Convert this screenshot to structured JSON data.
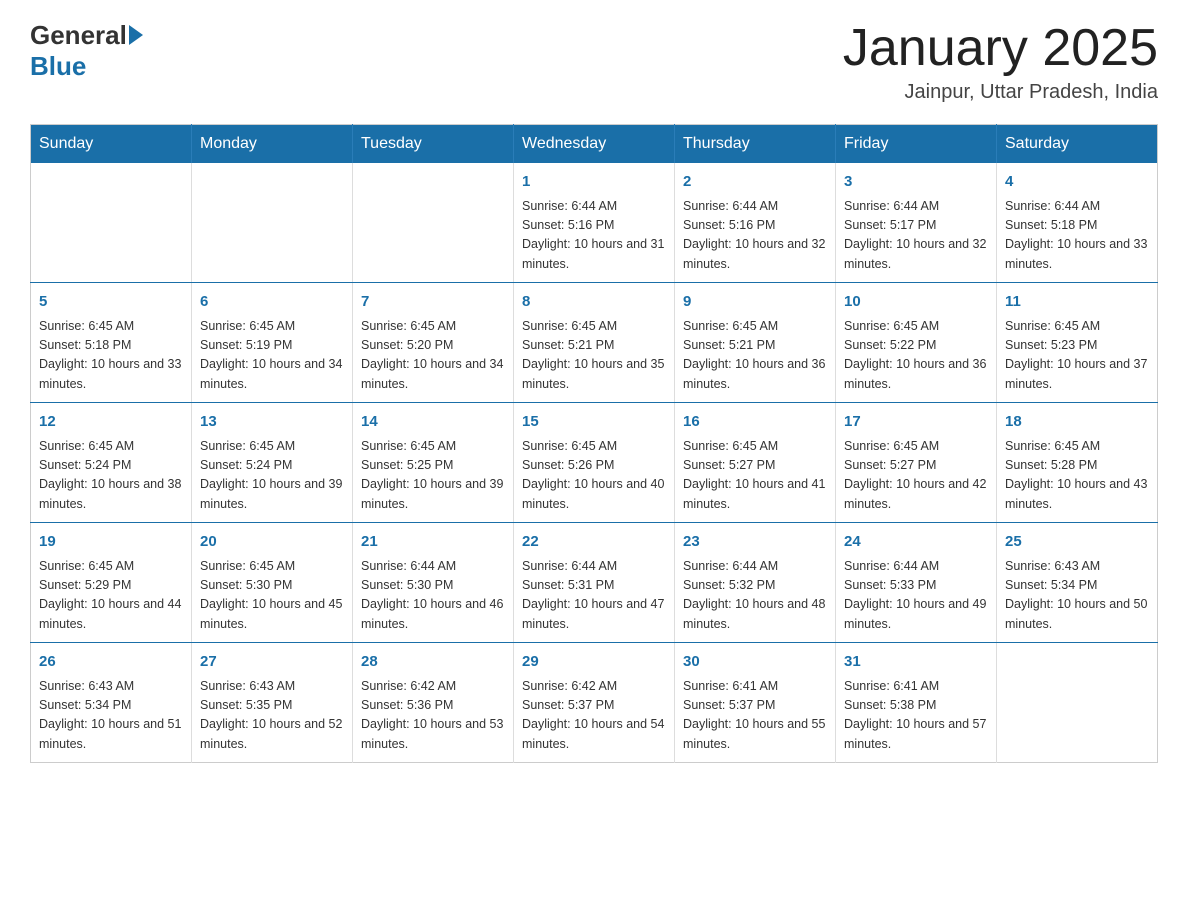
{
  "header": {
    "logo_general": "General",
    "logo_blue": "Blue",
    "month_title": "January 2025",
    "location": "Jainpur, Uttar Pradesh, India"
  },
  "days_of_week": [
    "Sunday",
    "Monday",
    "Tuesday",
    "Wednesday",
    "Thursday",
    "Friday",
    "Saturday"
  ],
  "weeks": [
    [
      {
        "day": "",
        "info": ""
      },
      {
        "day": "",
        "info": ""
      },
      {
        "day": "",
        "info": ""
      },
      {
        "day": "1",
        "info": "Sunrise: 6:44 AM\nSunset: 5:16 PM\nDaylight: 10 hours and 31 minutes."
      },
      {
        "day": "2",
        "info": "Sunrise: 6:44 AM\nSunset: 5:16 PM\nDaylight: 10 hours and 32 minutes."
      },
      {
        "day": "3",
        "info": "Sunrise: 6:44 AM\nSunset: 5:17 PM\nDaylight: 10 hours and 32 minutes."
      },
      {
        "day": "4",
        "info": "Sunrise: 6:44 AM\nSunset: 5:18 PM\nDaylight: 10 hours and 33 minutes."
      }
    ],
    [
      {
        "day": "5",
        "info": "Sunrise: 6:45 AM\nSunset: 5:18 PM\nDaylight: 10 hours and 33 minutes."
      },
      {
        "day": "6",
        "info": "Sunrise: 6:45 AM\nSunset: 5:19 PM\nDaylight: 10 hours and 34 minutes."
      },
      {
        "day": "7",
        "info": "Sunrise: 6:45 AM\nSunset: 5:20 PM\nDaylight: 10 hours and 34 minutes."
      },
      {
        "day": "8",
        "info": "Sunrise: 6:45 AM\nSunset: 5:21 PM\nDaylight: 10 hours and 35 minutes."
      },
      {
        "day": "9",
        "info": "Sunrise: 6:45 AM\nSunset: 5:21 PM\nDaylight: 10 hours and 36 minutes."
      },
      {
        "day": "10",
        "info": "Sunrise: 6:45 AM\nSunset: 5:22 PM\nDaylight: 10 hours and 36 minutes."
      },
      {
        "day": "11",
        "info": "Sunrise: 6:45 AM\nSunset: 5:23 PM\nDaylight: 10 hours and 37 minutes."
      }
    ],
    [
      {
        "day": "12",
        "info": "Sunrise: 6:45 AM\nSunset: 5:24 PM\nDaylight: 10 hours and 38 minutes."
      },
      {
        "day": "13",
        "info": "Sunrise: 6:45 AM\nSunset: 5:24 PM\nDaylight: 10 hours and 39 minutes."
      },
      {
        "day": "14",
        "info": "Sunrise: 6:45 AM\nSunset: 5:25 PM\nDaylight: 10 hours and 39 minutes."
      },
      {
        "day": "15",
        "info": "Sunrise: 6:45 AM\nSunset: 5:26 PM\nDaylight: 10 hours and 40 minutes."
      },
      {
        "day": "16",
        "info": "Sunrise: 6:45 AM\nSunset: 5:27 PM\nDaylight: 10 hours and 41 minutes."
      },
      {
        "day": "17",
        "info": "Sunrise: 6:45 AM\nSunset: 5:27 PM\nDaylight: 10 hours and 42 minutes."
      },
      {
        "day": "18",
        "info": "Sunrise: 6:45 AM\nSunset: 5:28 PM\nDaylight: 10 hours and 43 minutes."
      }
    ],
    [
      {
        "day": "19",
        "info": "Sunrise: 6:45 AM\nSunset: 5:29 PM\nDaylight: 10 hours and 44 minutes."
      },
      {
        "day": "20",
        "info": "Sunrise: 6:45 AM\nSunset: 5:30 PM\nDaylight: 10 hours and 45 minutes."
      },
      {
        "day": "21",
        "info": "Sunrise: 6:44 AM\nSunset: 5:30 PM\nDaylight: 10 hours and 46 minutes."
      },
      {
        "day": "22",
        "info": "Sunrise: 6:44 AM\nSunset: 5:31 PM\nDaylight: 10 hours and 47 minutes."
      },
      {
        "day": "23",
        "info": "Sunrise: 6:44 AM\nSunset: 5:32 PM\nDaylight: 10 hours and 48 minutes."
      },
      {
        "day": "24",
        "info": "Sunrise: 6:44 AM\nSunset: 5:33 PM\nDaylight: 10 hours and 49 minutes."
      },
      {
        "day": "25",
        "info": "Sunrise: 6:43 AM\nSunset: 5:34 PM\nDaylight: 10 hours and 50 minutes."
      }
    ],
    [
      {
        "day": "26",
        "info": "Sunrise: 6:43 AM\nSunset: 5:34 PM\nDaylight: 10 hours and 51 minutes."
      },
      {
        "day": "27",
        "info": "Sunrise: 6:43 AM\nSunset: 5:35 PM\nDaylight: 10 hours and 52 minutes."
      },
      {
        "day": "28",
        "info": "Sunrise: 6:42 AM\nSunset: 5:36 PM\nDaylight: 10 hours and 53 minutes."
      },
      {
        "day": "29",
        "info": "Sunrise: 6:42 AM\nSunset: 5:37 PM\nDaylight: 10 hours and 54 minutes."
      },
      {
        "day": "30",
        "info": "Sunrise: 6:41 AM\nSunset: 5:37 PM\nDaylight: 10 hours and 55 minutes."
      },
      {
        "day": "31",
        "info": "Sunrise: 6:41 AM\nSunset: 5:38 PM\nDaylight: 10 hours and 57 minutes."
      },
      {
        "day": "",
        "info": ""
      }
    ]
  ]
}
